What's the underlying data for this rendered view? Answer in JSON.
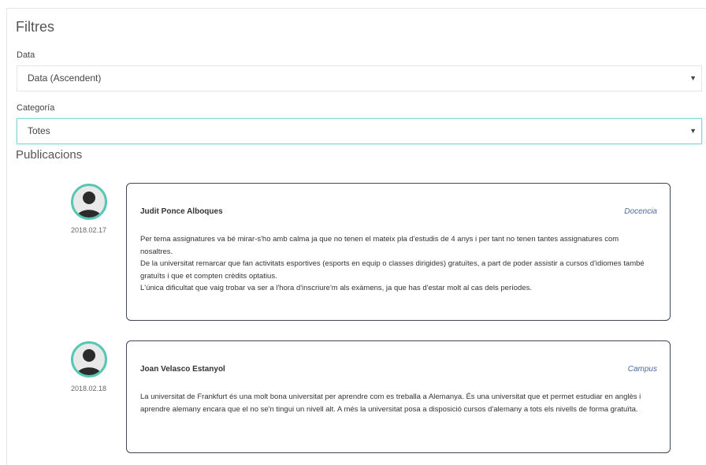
{
  "filters": {
    "title": "Filtres",
    "date_label": "Data",
    "date_value": "Data (Ascendent)",
    "category_label": "Categoría",
    "category_value": "Totes"
  },
  "publications": {
    "title": "Publicacions",
    "items": [
      {
        "date": "2018.02.17",
        "author": "Judit Ponce Alboques",
        "category": "Docencia",
        "lines": [
          "Per tema assignatures va bé mirar-s'ho amb calma ja que no tenen el mateix pla d'estudis de 4 anys i per tant no tenen tantes assignatures com nosaltres.",
          "De la universitat remarcar que fan activitats esportives (esports en equip o classes dirigides) gratuïtes, a part de poder assistir a cursos d'idiomes també gratuïts i que et compten crèdits optatius.",
          "L'única dificultat que vaig trobar va ser a l'hora d'inscriure'm als exàmens, ja que has d'estar molt al cas dels períodes."
        ]
      },
      {
        "date": "2018.02.18",
        "author": "Joan Velasco Estanyol",
        "category": "Campus",
        "lines": [
          "La universitat de Frankfurt és una molt bona universitat per aprendre com es treballa a Alemanya. És una universitat que et permet estudiar en anglès i aprendre alemany encara que el no se'n tingui un nivell alt. A més la universitat posa a disposició cursos d'alemany a tots els nivells de forma gratuïta."
        ]
      }
    ]
  },
  "colors": {
    "accent": "#55c7b2",
    "category_link": "#4d6aa0",
    "card_border": "#3c4858"
  },
  "icons": {
    "avatar": "user-avatar-icon",
    "caret": "caret-down-icon"
  }
}
